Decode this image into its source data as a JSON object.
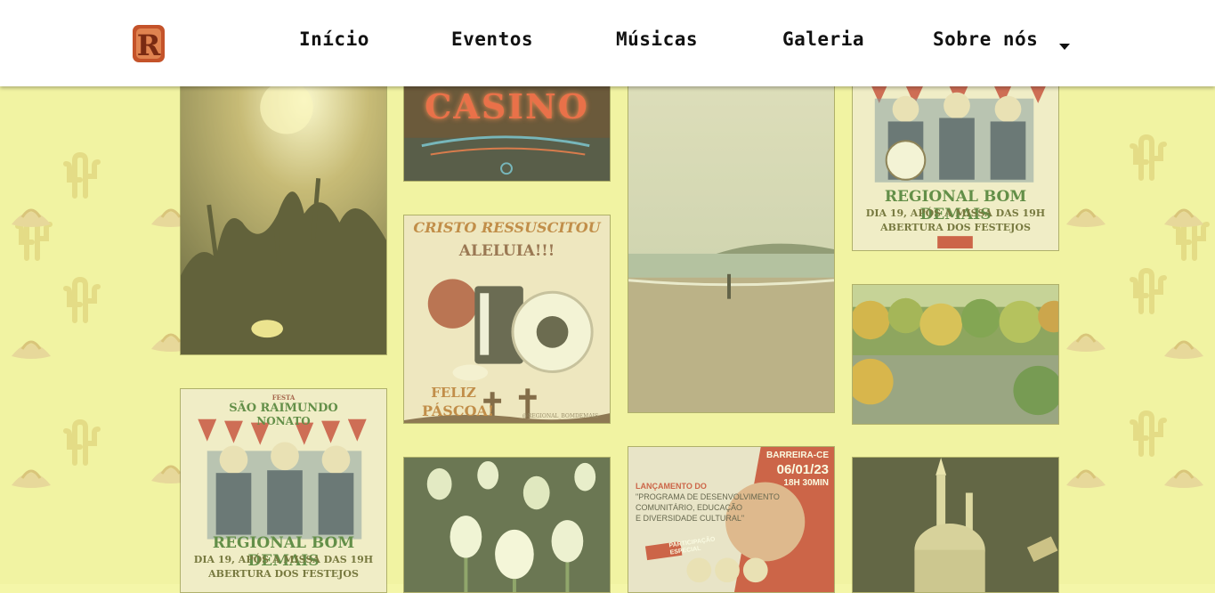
{
  "nav": {
    "items": [
      {
        "label": "Início"
      },
      {
        "label": "Eventos"
      },
      {
        "label": "Músicas"
      },
      {
        "label": "Galeria"
      },
      {
        "label": "Sobre nós"
      }
    ],
    "dropdown_icon": "caret-down-icon",
    "logo_letter": "R"
  },
  "gallery": {
    "casino": {
      "sign": "CASINO"
    },
    "easter": {
      "title": "CRISTO RESSUSCITOU",
      "subtitle": "ALELUIA!!!",
      "greeting_1": "FELIZ",
      "greeting_2": "PÁSCOA!",
      "handle": "@REGIONAL_BOMDEMAIS"
    },
    "festa_top": {
      "band": "REGIONAL BOM DEMAIS",
      "line1": "DIA 19, APÓS A MISSA DAS 19H",
      "line2": "ABERTURA DOS FESTEJOS"
    },
    "festa_bottom": {
      "tag": "FESTA",
      "saint_1": "SÃO RAIMUNDO",
      "saint_2": "NONATO",
      "band": "REGIONAL BOM DEMAIS",
      "line1": "DIA 19, APÓS A MISSA DAS 19H",
      "line2": "ABERTURA DOS FESTEJOS"
    },
    "launch": {
      "city": "BARREIRA-CE",
      "date": "06/01/23",
      "time": "18H 30MIN",
      "heading": "LANÇAMENTO DO",
      "program_1": "\"PROGRAMA DE DESENVOLVIMENTO",
      "program_2": "COMUNITÁRIO, EDUCAÇÃO",
      "program_3": "E DIVERSIDADE CULTURAL\"",
      "special_1": "PARTICIPAÇÃO",
      "special_2": "ESPECIAL"
    }
  },
  "colors": {
    "background": "#f1f3a2",
    "header": "#ffffff",
    "logo": "#c4532a",
    "poster_green": "#2f6a2a",
    "poster_red": "#c0302a"
  }
}
